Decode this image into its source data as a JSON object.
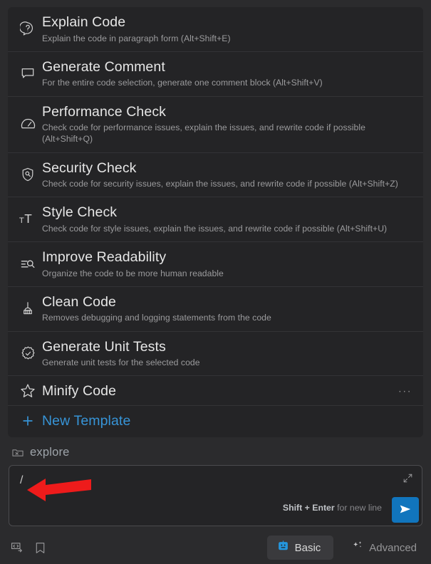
{
  "theme": {
    "page_bg": "#2b2b2d",
    "card_bg": "#242426",
    "divider": "#333336",
    "title_color": "#e6e6e6",
    "desc_color": "#9b9b9d",
    "accent_blue": "#3794d7",
    "send_blue": "#1175bd",
    "annotation_color": "#ee1b1b"
  },
  "templates": {
    "items": [
      {
        "title": "Explain Code",
        "desc": "Explain the code in paragraph form (Alt+Shift+E)",
        "icon": "question-bubble-icon",
        "shortcut": "Alt+Shift+E"
      },
      {
        "title": "Generate Comment",
        "desc": "For the entire code selection, generate one comment block (Alt+Shift+V)",
        "icon": "comment-bubble-icon",
        "shortcut": "Alt+Shift+V"
      },
      {
        "title": "Performance Check",
        "desc": "Check code for performance issues, explain the issues, and rewrite code if possible (Alt+Shift+Q)",
        "icon": "gauge-icon",
        "shortcut": "Alt+Shift+Q"
      },
      {
        "title": "Security Check",
        "desc": "Check code for security issues, explain the issues, and rewrite code if possible (Alt+Shift+Z)",
        "icon": "shield-search-icon",
        "shortcut": "Alt+Shift+Z"
      },
      {
        "title": "Style Check",
        "desc": "Check code for style issues, explain the issues, and rewrite code if possible (Alt+Shift+U)",
        "icon": "text-size-icon",
        "shortcut": "Alt+Shift+U"
      },
      {
        "title": "Improve Readability",
        "desc": "Organize the code to be more human readable",
        "icon": "list-search-icon",
        "shortcut": ""
      },
      {
        "title": "Clean Code",
        "desc": "Removes debugging and logging statements from the code",
        "icon": "broom-icon",
        "shortcut": ""
      },
      {
        "title": "Generate Unit Tests",
        "desc": "Generate unit tests for the selected code",
        "icon": "verified-check-icon",
        "shortcut": ""
      },
      {
        "title": "Minify Code",
        "desc": "",
        "icon": "star-icon",
        "shortcut": "",
        "more_label": "···"
      }
    ],
    "new_template_label": "New Template",
    "new_template_icon": "plus-icon"
  },
  "context": {
    "label": "explore",
    "icon": "folder-x-icon"
  },
  "prompt": {
    "value": "/",
    "placeholder": "",
    "expand_icon": "expand-diagonal-icon",
    "hint_bold": "Shift + Enter",
    "hint_rest": " for new line",
    "send_icon": "send-paper-plane-icon"
  },
  "bottom_bar": {
    "left_icons": [
      {
        "name": "insert-code-icon"
      },
      {
        "name": "bookmark-icon"
      }
    ],
    "modes": [
      {
        "label": "Basic",
        "icon": "robot-icon",
        "selected": true
      },
      {
        "label": "Advanced",
        "icon": "sparkles-icon",
        "selected": false
      }
    ]
  },
  "annotation": {
    "type": "arrow",
    "points_to": "prompt-input",
    "color": "#ee1b1b"
  }
}
